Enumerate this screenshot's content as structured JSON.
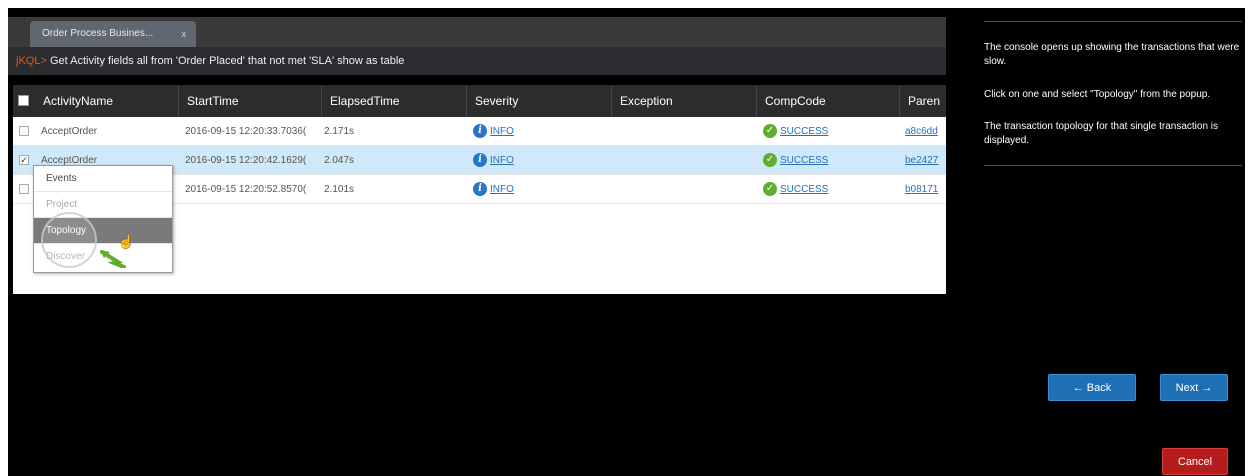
{
  "tab": {
    "label": "Order Process Busines...",
    "close": "x"
  },
  "query": {
    "prefix": "jKQL>",
    "text": " Get Activity fields all from 'Order Placed' that not met 'SLA' show as table"
  },
  "grid": {
    "headers": [
      "ActivityName",
      "StartTime",
      "ElapsedTime",
      "Severity",
      "Exception",
      "CompCode",
      "Paren"
    ],
    "rows": [
      {
        "check": "",
        "name": "AcceptOrder",
        "start": "2016-09-15 12:20:33.7036(",
        "elapsed": "2.171s",
        "severity": "INFO",
        "exception": "",
        "comp": "SUCCESS",
        "parent": "a8c6dd"
      },
      {
        "check": "✓",
        "name": "AcceptOrder",
        "start": "2016-09-15 12:20:42.1629(",
        "elapsed": "2.047s",
        "severity": "INFO",
        "exception": "",
        "comp": "SUCCESS",
        "parent": "be2427"
      },
      {
        "check": "",
        "name": "",
        "start": "2016-09-15 12:20:52.8570(",
        "elapsed": "2.101s",
        "severity": "INFO",
        "exception": "",
        "comp": "SUCCESS",
        "parent": "b08171"
      }
    ]
  },
  "popup": {
    "items": [
      "Events",
      "Project",
      "Topology",
      "Discover"
    ]
  },
  "instructions": {
    "p1": "The console opens up showing the transactions that were slow.",
    "p2": "Click on one and select \"Topology\" from the popup.",
    "p3": "The transaction topology for that single transaction is displayed."
  },
  "nav": {
    "back": "← Back",
    "next": "Next →",
    "cancel": "Cancel"
  },
  "colors": {
    "accent": "#1f6fb5",
    "danger": "#b71c1c",
    "success": "#5fae2e",
    "query_prefix": "#e35c20"
  }
}
